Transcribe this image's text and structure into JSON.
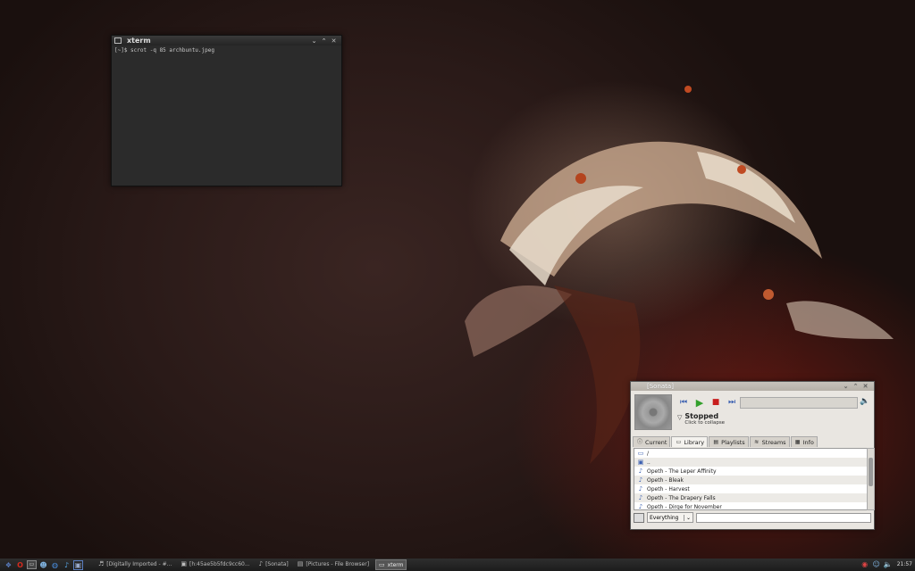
{
  "xterm": {
    "title": "xterm",
    "lines": [
      "[~]$ scrot -q 85 archbuntu.jpeg"
    ]
  },
  "sonata": {
    "title": "[Sonata]",
    "status_title": "Stopped",
    "status_sub": "Click to collapse",
    "tabs": [
      {
        "label": "Current",
        "icon": "info-icon",
        "glyph": "ⓘ"
      },
      {
        "label": "Library",
        "icon": "library-icon",
        "glyph": "▭"
      },
      {
        "label": "Playlists",
        "icon": "playlist-icon",
        "glyph": "▤"
      },
      {
        "label": "Streams",
        "icon": "streams-icon",
        "glyph": "≋"
      },
      {
        "label": "Info",
        "icon": "info-book-icon",
        "glyph": "▦"
      }
    ],
    "library": [
      {
        "label": "/",
        "icon": "folder-icon",
        "glyph": "▭"
      },
      {
        "label": "..",
        "icon": "up-folder-icon",
        "glyph": "▣"
      },
      {
        "label": "Opeth - The Leper Affinity",
        "icon": "music-file-icon",
        "glyph": "♪"
      },
      {
        "label": "Opeth - Bleak",
        "icon": "music-file-icon",
        "glyph": "♪"
      },
      {
        "label": "Opeth - Harvest",
        "icon": "music-file-icon",
        "glyph": "♪"
      },
      {
        "label": "Opeth - The Drapery Falls",
        "icon": "music-file-icon",
        "glyph": "♪"
      },
      {
        "label": "Opeth - Dirge for November",
        "icon": "music-file-icon",
        "glyph": "♪"
      }
    ],
    "filter": "Everything",
    "search_value": ""
  },
  "taskbar": {
    "tasks": [
      {
        "label": "[Digitally Imported - #...",
        "glyph": "♬",
        "name": "task-digitally-imported"
      },
      {
        "label": "[h:45ae5b5fdc9cc60...",
        "glyph": "▣",
        "name": "task-hash"
      },
      {
        "label": "[Sonata]",
        "glyph": "♪",
        "name": "task-sonata"
      },
      {
        "label": "[Pictures - File Browser]",
        "glyph": "▤",
        "name": "task-file-browser"
      },
      {
        "label": "xterm",
        "glyph": "▭",
        "name": "task-xterm"
      }
    ],
    "clock": "21:57"
  },
  "colors": {
    "accent": "#3a5fb0",
    "play": "#33a02c",
    "stop": "#c81e1e"
  }
}
